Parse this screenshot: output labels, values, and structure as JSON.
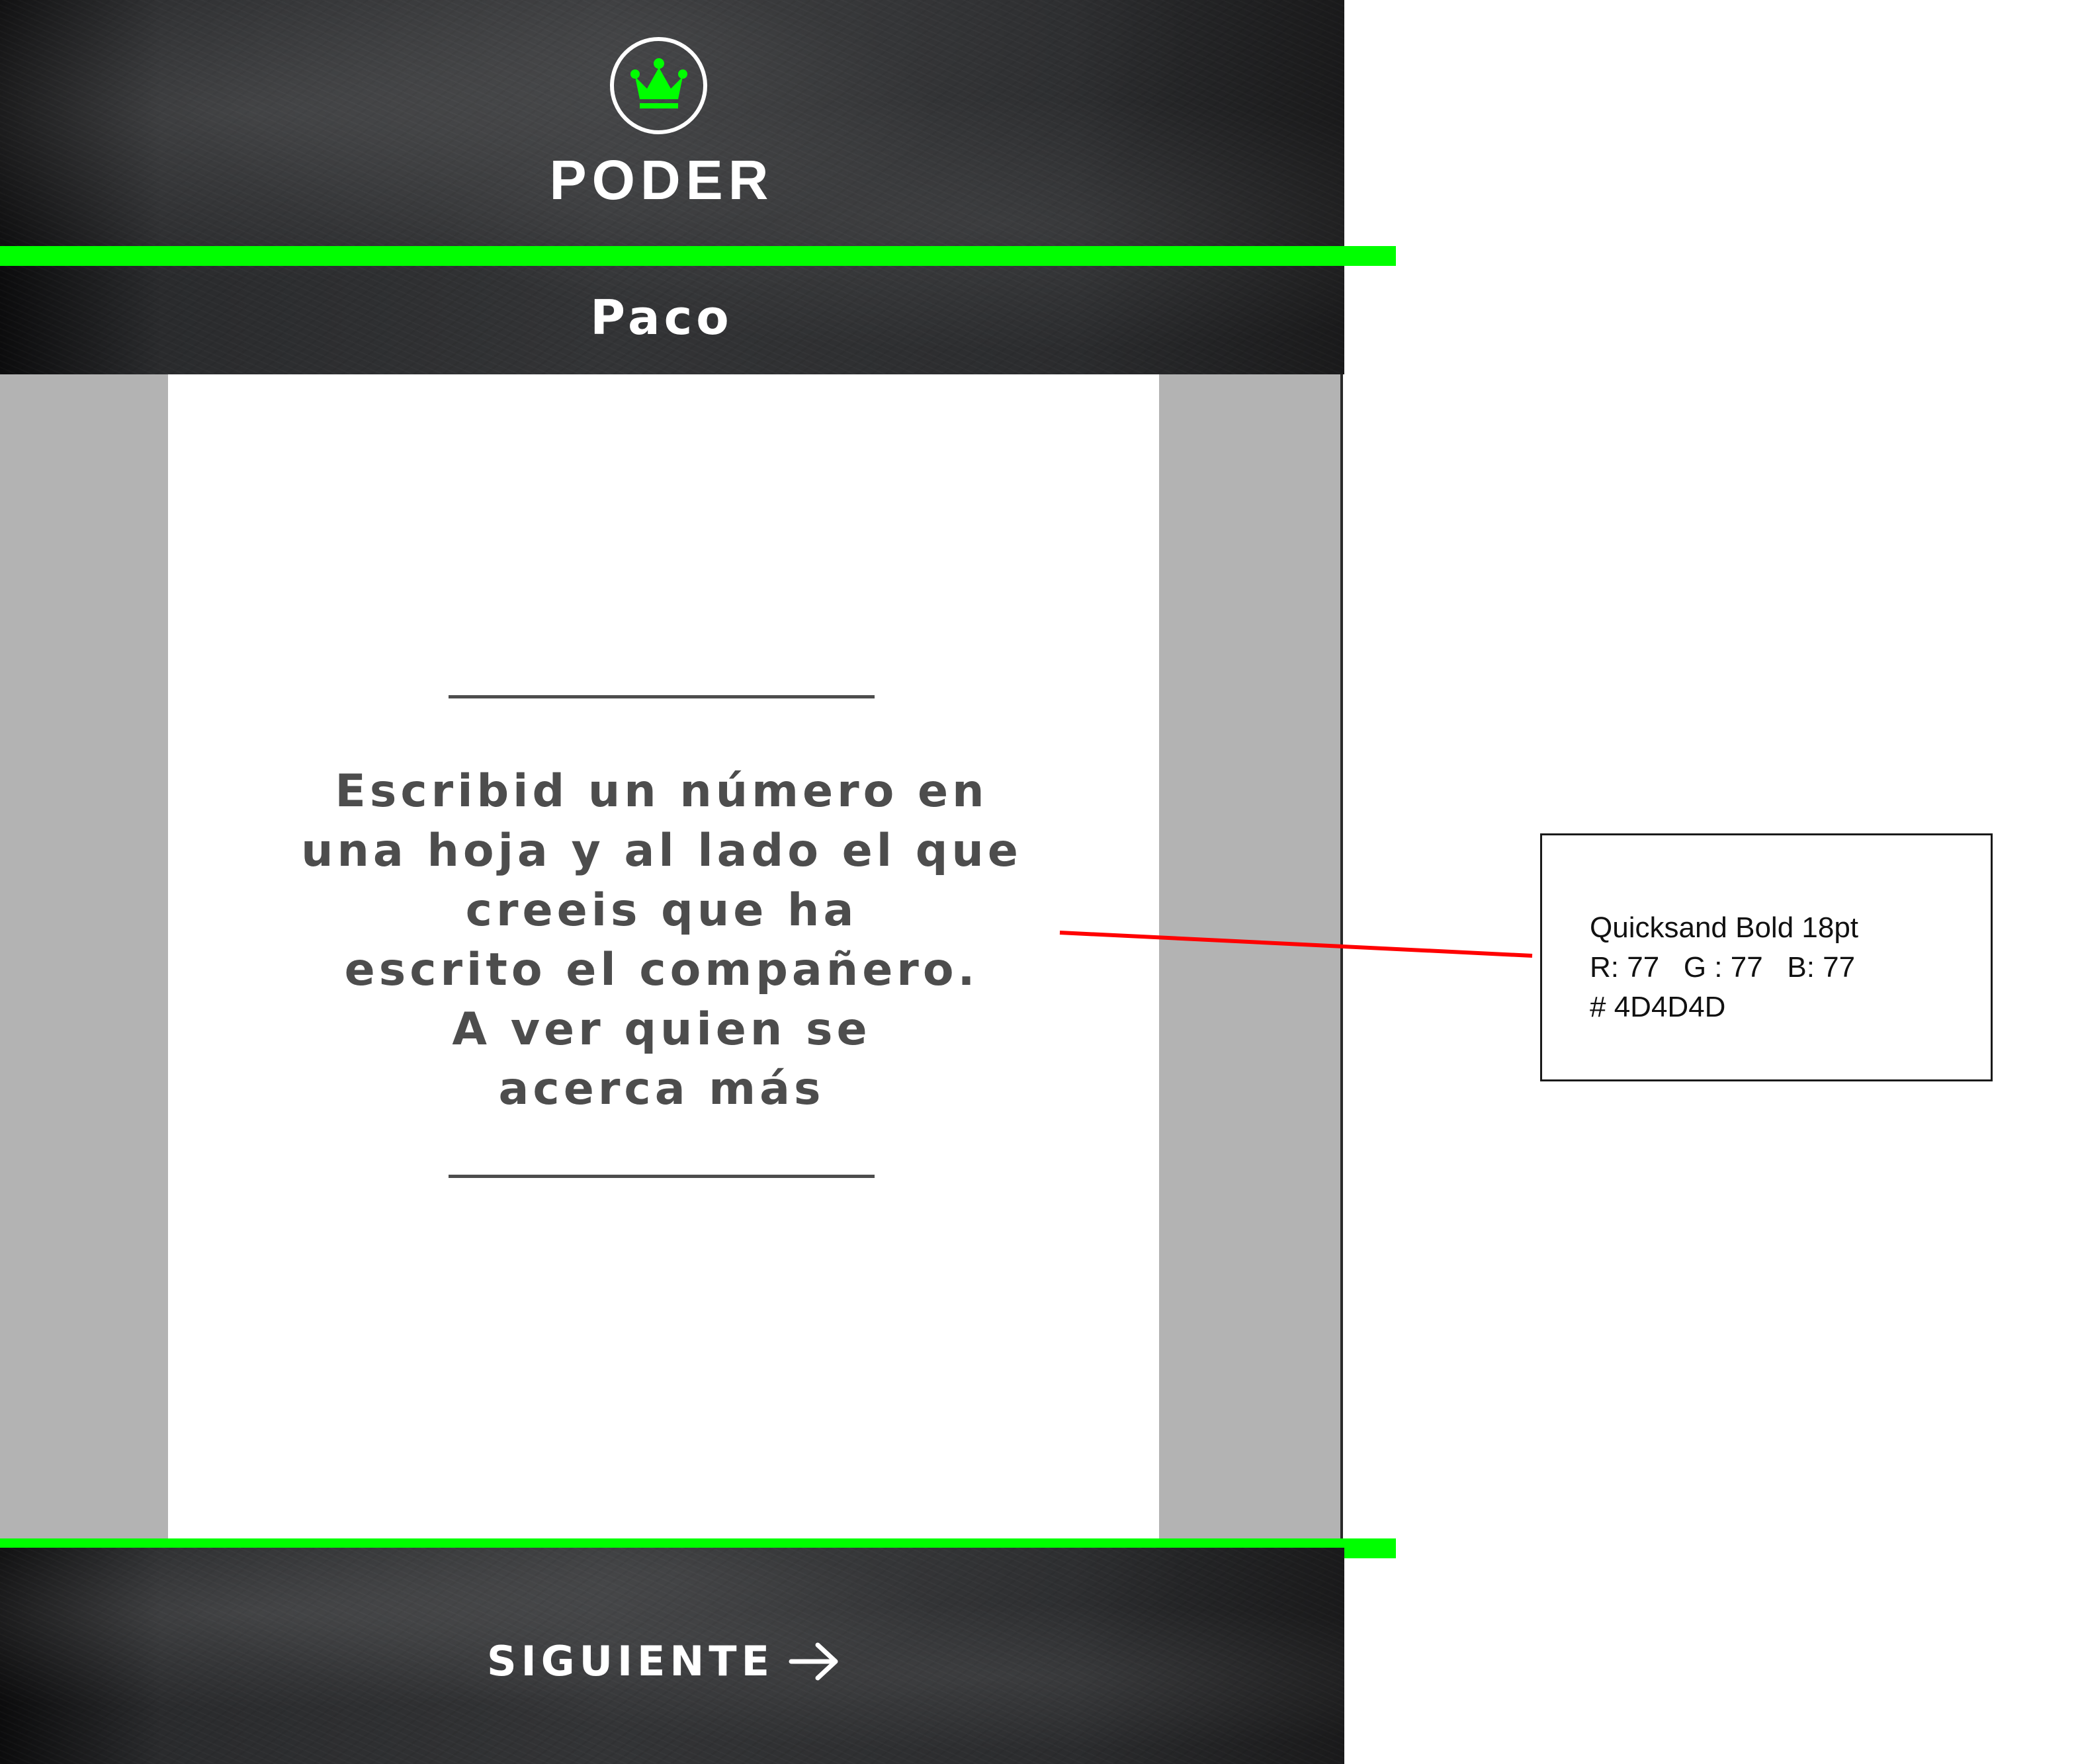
{
  "header": {
    "title": "PODER",
    "logo_icon": "crown-icon",
    "player_name": "Paco"
  },
  "card": {
    "prompt": "Escribid un número en\nuna hoja y al lado el que\ncreeis que ha\nescrito el compañero.\nA ver quien se\nacerca más"
  },
  "footer": {
    "next_label": "SIGUIENTE",
    "next_icon": "arrow-right-icon"
  },
  "annotation": {
    "font_spec": "Quicksand Bold 18pt",
    "rgb_spec": "R: 77   G : 77   B: 77",
    "hex_spec": "# 4D4D4D"
  },
  "colors": {
    "accent_green": "#00ff00",
    "text_gray": "#4d4d4d",
    "side_gray": "#b3b3b3",
    "annotation_red": "#ff0000",
    "board_dark": "#2a2b2d"
  }
}
